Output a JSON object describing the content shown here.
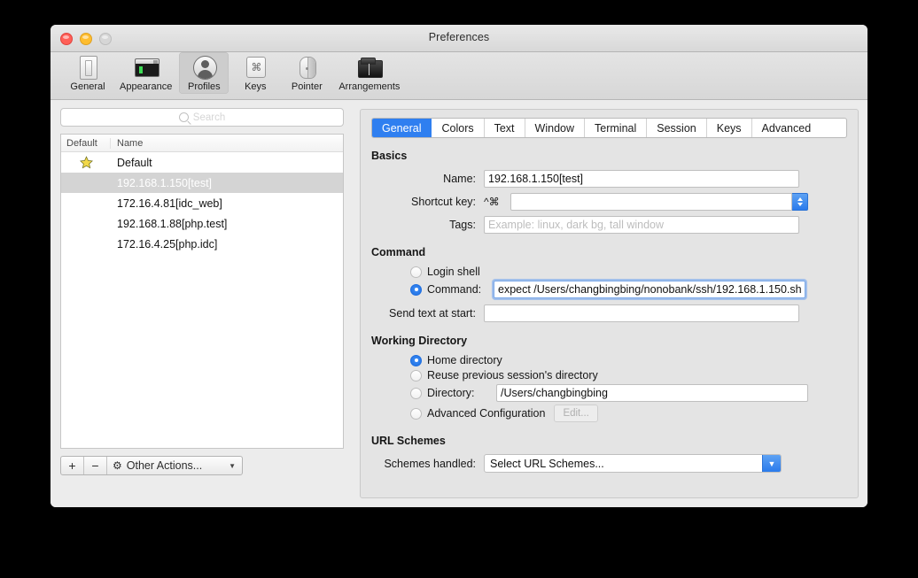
{
  "window": {
    "title": "Preferences",
    "traffic_lights": [
      "close-button",
      "minimize-button",
      "zoom-button"
    ]
  },
  "toolbar": {
    "items": [
      {
        "label": "General",
        "icon": "display-icon",
        "selected": false
      },
      {
        "label": "Appearance",
        "icon": "terminal-window-icon",
        "selected": false
      },
      {
        "label": "Profiles",
        "icon": "person-silhouette-icon",
        "selected": true
      },
      {
        "label": "Keys",
        "icon": "command-key-icon",
        "selected": false
      },
      {
        "label": "Pointer",
        "icon": "mouse-icon",
        "selected": false
      },
      {
        "label": "Arrangements",
        "icon": "windows-stack-icon",
        "selected": false
      }
    ]
  },
  "sidebar": {
    "search": {
      "placeholder": "Search",
      "value": "",
      "icon": "search-icon"
    },
    "columns": [
      "Default",
      "Name"
    ],
    "rows": [
      {
        "name": "Default",
        "default": true,
        "selected": false
      },
      {
        "name": "192.168.1.150[test]",
        "default": false,
        "selected": true
      },
      {
        "name": "172.16.4.81[idc_web]",
        "default": false,
        "selected": false
      },
      {
        "name": "192.168.1.88[php.test]",
        "default": false,
        "selected": false
      },
      {
        "name": "172.16.4.25[php.idc]",
        "default": false,
        "selected": false
      }
    ],
    "tools": {
      "add_label": "+",
      "remove_label": "−",
      "other_actions_label": "Other Actions...",
      "gear_icon": "gear-icon",
      "chevron_icon": "chevron-down-icon"
    }
  },
  "tabs": [
    {
      "label": "General",
      "active": true
    },
    {
      "label": "Colors",
      "active": false
    },
    {
      "label": "Text",
      "active": false
    },
    {
      "label": "Window",
      "active": false
    },
    {
      "label": "Terminal",
      "active": false
    },
    {
      "label": "Session",
      "active": false
    },
    {
      "label": "Keys",
      "active": false
    },
    {
      "label": "Advanced",
      "active": false
    }
  ],
  "general_tab": {
    "basics": {
      "title": "Basics",
      "name_label": "Name:",
      "name_value": "192.168.1.150[test]",
      "shortcut_label": "Shortcut key:",
      "shortcut_modifiers": "^⌘",
      "shortcut_value": "",
      "tags_label": "Tags:",
      "tags_value": "",
      "tags_placeholder": "Example: linux, dark bg, tall window"
    },
    "command": {
      "title": "Command",
      "login_shell_label": "Login shell",
      "login_shell_selected": false,
      "command_label": "Command:",
      "command_selected": true,
      "command_value": "expect /Users/changbingbing/nonobank/ssh/192.168.1.150.sh",
      "send_text_label": "Send text at start:",
      "send_text_value": ""
    },
    "working_directory": {
      "title": "Working Directory",
      "options": [
        {
          "label": "Home directory",
          "selected": true
        },
        {
          "label": "Reuse previous session's directory",
          "selected": false
        },
        {
          "label": "Directory:",
          "selected": false
        },
        {
          "label": "Advanced Configuration",
          "selected": false
        }
      ],
      "directory_value": "/Users/changbingbing",
      "edit_button_label": "Edit...",
      "edit_button_enabled": false
    },
    "url_schemes": {
      "title": "URL Schemes",
      "schemes_label": "Schemes handled:",
      "schemes_value": "Select URL Schemes..."
    }
  },
  "colors": {
    "accent": "#2f7ff0",
    "window_bg": "#ececec",
    "panel_bg": "#e4e4e4",
    "selection_inactive": "#d4d4d4",
    "star": "#f2d84a"
  }
}
